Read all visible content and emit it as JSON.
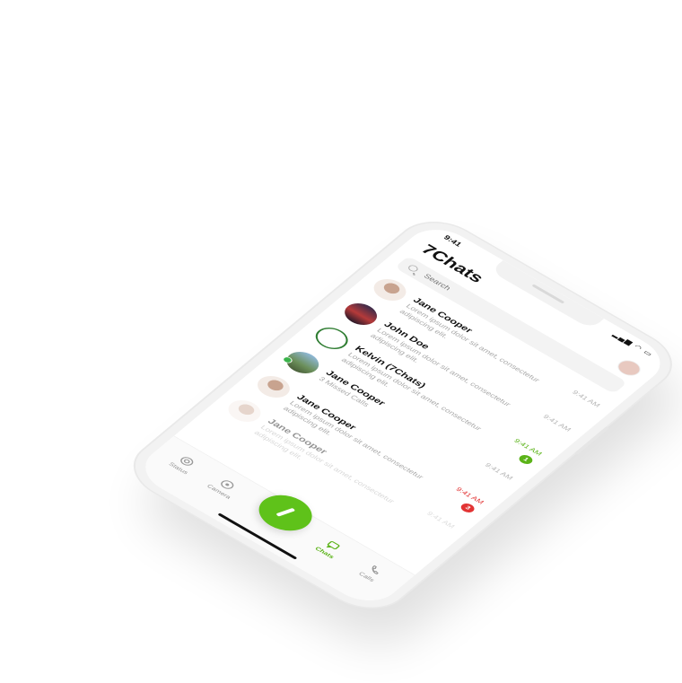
{
  "status_bar": {
    "time": "9:41"
  },
  "app": {
    "title": "7Chats"
  },
  "search": {
    "placeholder": "Search"
  },
  "chats": [
    {
      "name": "Jane Cooper",
      "message": "Lorem ipsum dolor sit amet, consectetur adipiscing elit.",
      "time": "9:41 AM",
      "avatar": "woman-avatar",
      "badge": ""
    },
    {
      "name": "John Doe",
      "message": "Lorem ipsum dolor sit amet, consectetur adipiscing elit.",
      "time": "9:41 AM",
      "avatar": "sunset-avatar",
      "badge": ""
    },
    {
      "name": "Kelvin (7Chats)",
      "message": "Lorem ipsum dolor sit amet, consectetur adipiscing elit.",
      "time": "9:41 AM",
      "avatar": "logo-avatar",
      "badge": "1"
    },
    {
      "name": "Jane Cooper",
      "message": "3 Missed Calls",
      "time": "9:41 AM",
      "avatar": "house-avatar",
      "badge": ""
    },
    {
      "name": "Jane Cooper",
      "message": "Lorem ipsum dolor sit amet, consectetur adipiscing elit.",
      "time": "9:41 AM",
      "avatar": "woman-avatar",
      "badge": "3"
    },
    {
      "name": "Jane Cooper",
      "message": "Lorem ipsum dolor sit amet, consectetur adipiscing elit.",
      "time": "9:41 AM",
      "avatar": "woman-avatar",
      "badge": ""
    }
  ],
  "tabs": [
    {
      "label": "Status",
      "icon": "status-icon"
    },
    {
      "label": "Camera",
      "icon": "camera-icon"
    },
    {
      "label": "Chats",
      "icon": "chats-icon"
    },
    {
      "label": "Calls",
      "icon": "calls-icon"
    }
  ],
  "colors": {
    "accent": "#5fc21a",
    "missed": "#e23333"
  }
}
